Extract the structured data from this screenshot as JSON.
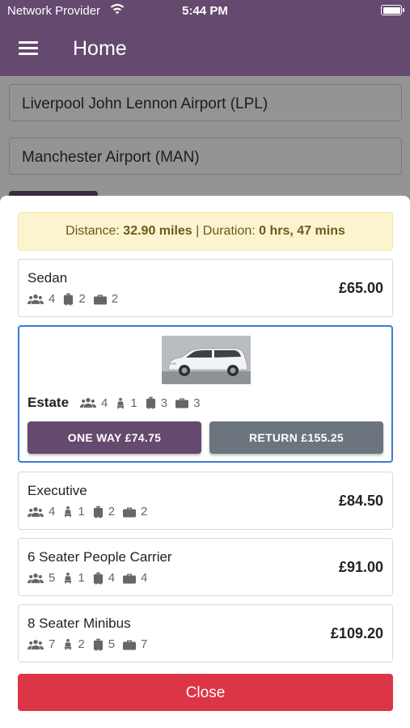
{
  "status_bar": {
    "carrier": "Network Provider",
    "time": "5:44 PM"
  },
  "app_bar": {
    "title": "Home"
  },
  "background_form": {
    "pickup": "Liverpool John Lennon Airport (LPL)",
    "dropoff": "Manchester Airport (MAN)"
  },
  "sheet": {
    "distance_label": "Distance:",
    "distance_value": "32.90 miles",
    "separator": "|",
    "duration_label": "Duration:",
    "duration_value": "0 hrs, 47 mins",
    "vehicles": [
      {
        "name": "Sedan",
        "price": "£65.00",
        "passengers": "4",
        "luggage": "2",
        "hand_luggage": "2"
      },
      {
        "name": "Estate",
        "passengers": "4",
        "child_seats": "1",
        "luggage": "3",
        "hand_luggage": "3",
        "one_way_label": "ONE WAY £74.75",
        "return_label": "RETURN £155.25"
      },
      {
        "name": "Executive",
        "price": "£84.50",
        "passengers": "4",
        "child_seats": "1",
        "luggage": "2",
        "hand_luggage": "2"
      },
      {
        "name": "6 Seater People Carrier",
        "price": "£91.00",
        "passengers": "5",
        "child_seats": "1",
        "luggage": "4",
        "hand_luggage": "4"
      },
      {
        "name": "8 Seater Minibus",
        "price": "£109.20",
        "passengers": "7",
        "child_seats": "2",
        "luggage": "5",
        "hand_luggage": "7"
      }
    ],
    "close_label": "Close"
  },
  "colors": {
    "brand": "#65496f",
    "selected_border": "#3a7bd5",
    "secondary": "#6c757d",
    "danger": "#dc3545",
    "info_bg": "#fcf3cf"
  }
}
